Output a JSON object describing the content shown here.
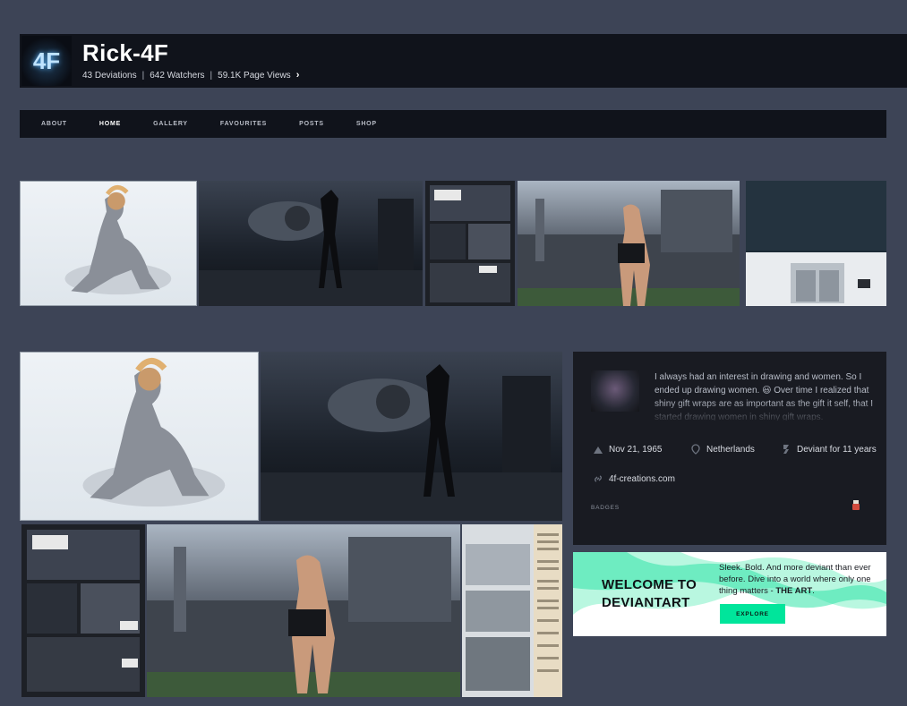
{
  "profile": {
    "avatar_text": "4F",
    "username": "Rick-4F",
    "deviations": "43 Deviations",
    "watchers": "642 Watchers",
    "page_views": "59.1K Page Views",
    "separator": "|",
    "chevron": "›"
  },
  "nav": {
    "tabs": [
      {
        "label": "ABOUT",
        "active": false
      },
      {
        "label": "HOME",
        "active": true
      },
      {
        "label": "GALLERY",
        "active": false
      },
      {
        "label": "FAVOURITES",
        "active": false
      },
      {
        "label": "POSTS",
        "active": false
      },
      {
        "label": "SHOP",
        "active": false
      }
    ]
  },
  "about": {
    "bio": "I always had an interest in drawing and women. So I ended up drawing women. 😃 Over time I realized that shiny gift wraps are as important as the gift it self, that I started drawing women in shiny gift wraps.",
    "birthday": "Nov 21, 1965",
    "location": "Netherlands",
    "deviant_for": "Deviant for 11 years",
    "website": "4f-creations.com",
    "badges_label": "BADGES"
  },
  "welcome": {
    "title_line1": "WELCOME TO",
    "title_line2": "DEVIANTART",
    "text_part1": "Sleek. Bold. And more deviant than ever before. Dive into a world where only one thing matters - ",
    "text_bold": "THE ART",
    "text_end": ".",
    "button_label": "EXPLORE"
  },
  "colors": {
    "background": "#3d4456",
    "panel": "#10131b",
    "card": "#191b22",
    "accent": "#00e59b"
  }
}
